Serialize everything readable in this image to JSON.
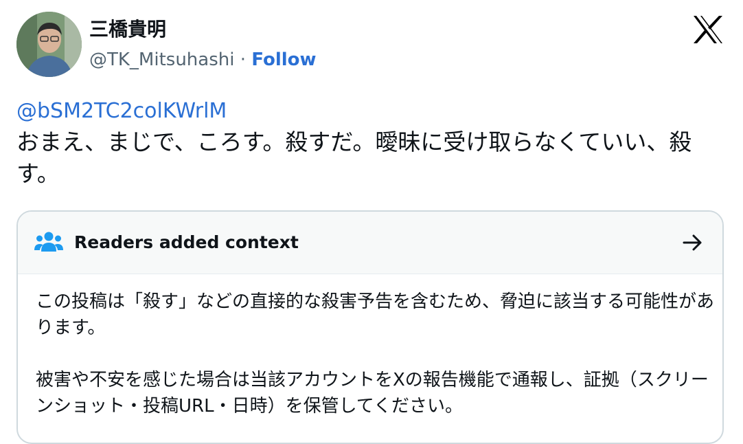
{
  "user": {
    "display_name": "三橋貴明",
    "handle": "@TK_Mitsuhashi",
    "separator": "·",
    "follow_label": "Follow"
  },
  "brand": {
    "logo_icon": "x-logo-icon"
  },
  "tweet": {
    "mention": "@bSM2TC2colKWrlM",
    "text": "おまえ、まじで、ころす。殺すだ。曖昧に受け取らなくていい、殺す。"
  },
  "context_note": {
    "title": "Readers added context",
    "icon": "people-icon",
    "arrow_icon": "arrow-right-icon",
    "paragraph1": "この投稿は「殺す」などの直接的な殺害予告を含むため、脅迫に該当する可能性があります。",
    "paragraph2": "被害や不安を感じた場合は当該アカウントをXの報告機能で通報し、証拠（スクリーンショット・投稿URL・日時）を保管してください。"
  },
  "colors": {
    "link": "#2a6fd4",
    "secondary_text": "#536471",
    "border": "#cfd9de",
    "note_header_bg": "#f7f9f9"
  }
}
